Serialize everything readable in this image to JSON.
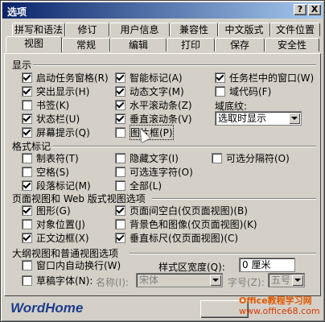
{
  "window": {
    "title": "选项",
    "help_label": "?",
    "close_label": "X"
  },
  "tabs_row1": [
    "拼写和语法",
    "修订",
    "用户信息",
    "兼容性",
    "中文版式",
    "文件位置"
  ],
  "tabs_row2": [
    "视图",
    "常规",
    "编辑",
    "打印",
    "保存",
    "安全性"
  ],
  "active_tab": "视图",
  "display": {
    "heading": "显示",
    "col1": [
      {
        "label": "启动任务窗格(R)",
        "checked": true
      },
      {
        "label": "突出显示(H)",
        "checked": true
      },
      {
        "label": "书签(K)",
        "checked": false
      },
      {
        "label": "状态栏(U)",
        "checked": true
      },
      {
        "label": "屏幕提示(Q)",
        "checked": true
      }
    ],
    "col2": [
      {
        "label": "智能标记(A)",
        "checked": true
      },
      {
        "label": "动态文字(M)",
        "checked": true
      },
      {
        "label": "水平滚动条(Z)",
        "checked": true
      },
      {
        "label": "垂直滚动条(V)",
        "checked": true
      },
      {
        "label": "图片框(P)",
        "checked": false
      }
    ],
    "col3": [
      {
        "label": "任务栏中的窗口(W)",
        "checked": true
      },
      {
        "label": "域代码(F)",
        "checked": false
      }
    ],
    "field_shading_label": "域底纹:",
    "field_shading_value": "选取时显示"
  },
  "format_marks": {
    "heading": "格式标记",
    "col1": [
      {
        "label": "制表符(T)",
        "checked": false
      },
      {
        "label": "空格(S)",
        "checked": false
      },
      {
        "label": "段落标记(M)",
        "checked": true
      }
    ],
    "col2": [
      {
        "label": "隐藏文字(I)",
        "checked": false
      },
      {
        "label": "可选连字符(O)",
        "checked": false
      },
      {
        "label": "全部(L)",
        "checked": false
      }
    ],
    "col3": [
      {
        "label": "可选分隔符(O)",
        "checked": false
      }
    ]
  },
  "page_web": {
    "heading": "页面视图和 Web 版式视图选项",
    "col1": [
      {
        "label": "图形(G)",
        "checked": true
      },
      {
        "label": "对象位置(J)",
        "checked": false
      },
      {
        "label": "正文边框(X)",
        "checked": true
      }
    ],
    "col2": [
      {
        "label": "页面间空白(仅页面视图)(B)",
        "checked": true
      },
      {
        "label": "背景色和图像(仅页面视图)(K)",
        "checked": false
      },
      {
        "label": "垂直标尺(仅页面视图)(C)",
        "checked": true
      }
    ]
  },
  "outline_normal": {
    "heading": "大纲视图和普通视图选项",
    "wrap_label": "窗口内自动换行(W)",
    "wrap_checked": false,
    "draft_label": "草稿字体(N):",
    "draft_checked": false,
    "style_width_label": "样式区宽度(Q):",
    "style_width_value": "0 厘米",
    "name_label": "名称(I):",
    "name_value": "宋体",
    "size_label": "字号(Z):",
    "size_value": "五号"
  },
  "branding": {
    "logo": "WordHome",
    "watermark_line1": "Office教程学习网",
    "watermark_line2": "www.office68.com"
  }
}
